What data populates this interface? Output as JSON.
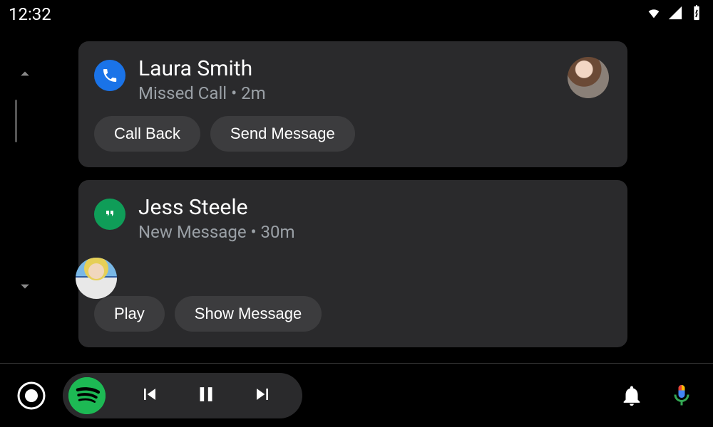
{
  "status": {
    "time": "12:32"
  },
  "cards": [
    {
      "icon": "phone-icon",
      "icon_bg": "#1a73e8",
      "title": "Laura Smith",
      "subtitle": "Missed Call • 2m",
      "avatar": "avatar-a",
      "actions": [
        {
          "name": "call-back-button",
          "label": "Call Back"
        },
        {
          "name": "send-message-button",
          "label": "Send Message"
        }
      ]
    },
    {
      "icon": "hangouts-icon",
      "icon_bg": "#0f9d58",
      "title": "Jess Steele",
      "subtitle": "New Message • 30m",
      "avatar": "avatar-b",
      "actions": [
        {
          "name": "play-button",
          "label": "Play"
        },
        {
          "name": "show-message-button",
          "label": "Show Message"
        }
      ]
    }
  ]
}
